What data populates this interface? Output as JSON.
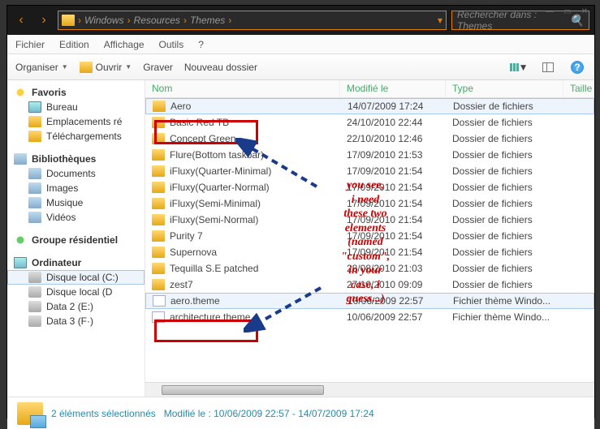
{
  "breadcrumb": [
    "Windows",
    "Resources",
    "Themes"
  ],
  "search_placeholder": "Rechercher dans : Themes",
  "menu": {
    "file": "Fichier",
    "edit": "Edition",
    "view": "Affichage",
    "tools": "Outils",
    "help": "?"
  },
  "toolbar": {
    "organize": "Organiser",
    "open": "Ouvrir",
    "burn": "Graver",
    "newfolder": "Nouveau dossier"
  },
  "sidebar": {
    "favorites": {
      "label": "Favoris",
      "items": [
        "Bureau",
        "Emplacements ré",
        "Téléchargements"
      ]
    },
    "libraries": {
      "label": "Bibliothèques",
      "items": [
        "Documents",
        "Images",
        "Musique",
        "Vidéos"
      ]
    },
    "homegroup": {
      "label": "Groupe résidentiel"
    },
    "computer": {
      "label": "Ordinateur",
      "items": [
        "Disque local (C:)",
        "Disque local (D",
        "Data 2 (E:)",
        "Data 3 (F·)"
      ]
    }
  },
  "columns": {
    "name": "Nom",
    "modified": "Modifié le",
    "type": "Type",
    "size": "Taille"
  },
  "rows": [
    {
      "icon": "folder",
      "name": "Aero",
      "date": "14/07/2009 17:24",
      "type": "Dossier de fichiers",
      "sel": true
    },
    {
      "icon": "folder",
      "name": "Basic Red TB",
      "date": "24/10/2010 22:44",
      "type": "Dossier de fichiers"
    },
    {
      "icon": "folder",
      "name": "Concept Green",
      "date": "22/10/2010 12:46",
      "type": "Dossier de fichiers"
    },
    {
      "icon": "folder",
      "name": "Flure(Bottom taskbar)",
      "date": "17/09/2010 21:53",
      "type": "Dossier de fichiers"
    },
    {
      "icon": "folder",
      "name": "iFluxy(Quarter-Minimal)",
      "date": "17/09/2010 21:54",
      "type": "Dossier de fichiers"
    },
    {
      "icon": "folder",
      "name": "iFluxy(Quarter-Normal)",
      "date": "17/09/2010 21:54",
      "type": "Dossier de fichiers"
    },
    {
      "icon": "folder",
      "name": "iFluxy(Semi-Minimal)",
      "date": "17/09/2010 21:54",
      "type": "Dossier de fichiers"
    },
    {
      "icon": "folder",
      "name": "iFluxy(Semi-Normal)",
      "date": "17/09/2010 21:54",
      "type": "Dossier de fichiers"
    },
    {
      "icon": "folder",
      "name": "Purity 7",
      "date": "17/09/2010 21:54",
      "type": "Dossier de fichiers"
    },
    {
      "icon": "folder",
      "name": "Supernova",
      "date": "17/09/2010 21:54",
      "type": "Dossier de fichiers"
    },
    {
      "icon": "folder",
      "name": "Tequilla S.E patched",
      "date": "28/08/2010 21:03",
      "type": "Dossier de fichiers"
    },
    {
      "icon": "folder",
      "name": "zest7",
      "date": "27/10/2010 09:09",
      "type": "Dossier de fichiers"
    },
    {
      "icon": "doc",
      "name": "aero.theme",
      "date": "10/06/2009 22:57",
      "type": "Fichier thème Windo...",
      "sel": true
    },
    {
      "icon": "doc",
      "name": "architecture.theme",
      "date": "10/06/2009 22:57",
      "type": "Fichier thème Windo..."
    }
  ],
  "status": {
    "count": "2 éléments sélectionnés",
    "mod": "Modifié le : 10/06/2009 22:57 - 14/07/2009 17:24"
  },
  "annotation": "you see,\ni need\nthese two\nelements\n(named\n\"custom\",\nin your\ncase, i\nguess...)"
}
